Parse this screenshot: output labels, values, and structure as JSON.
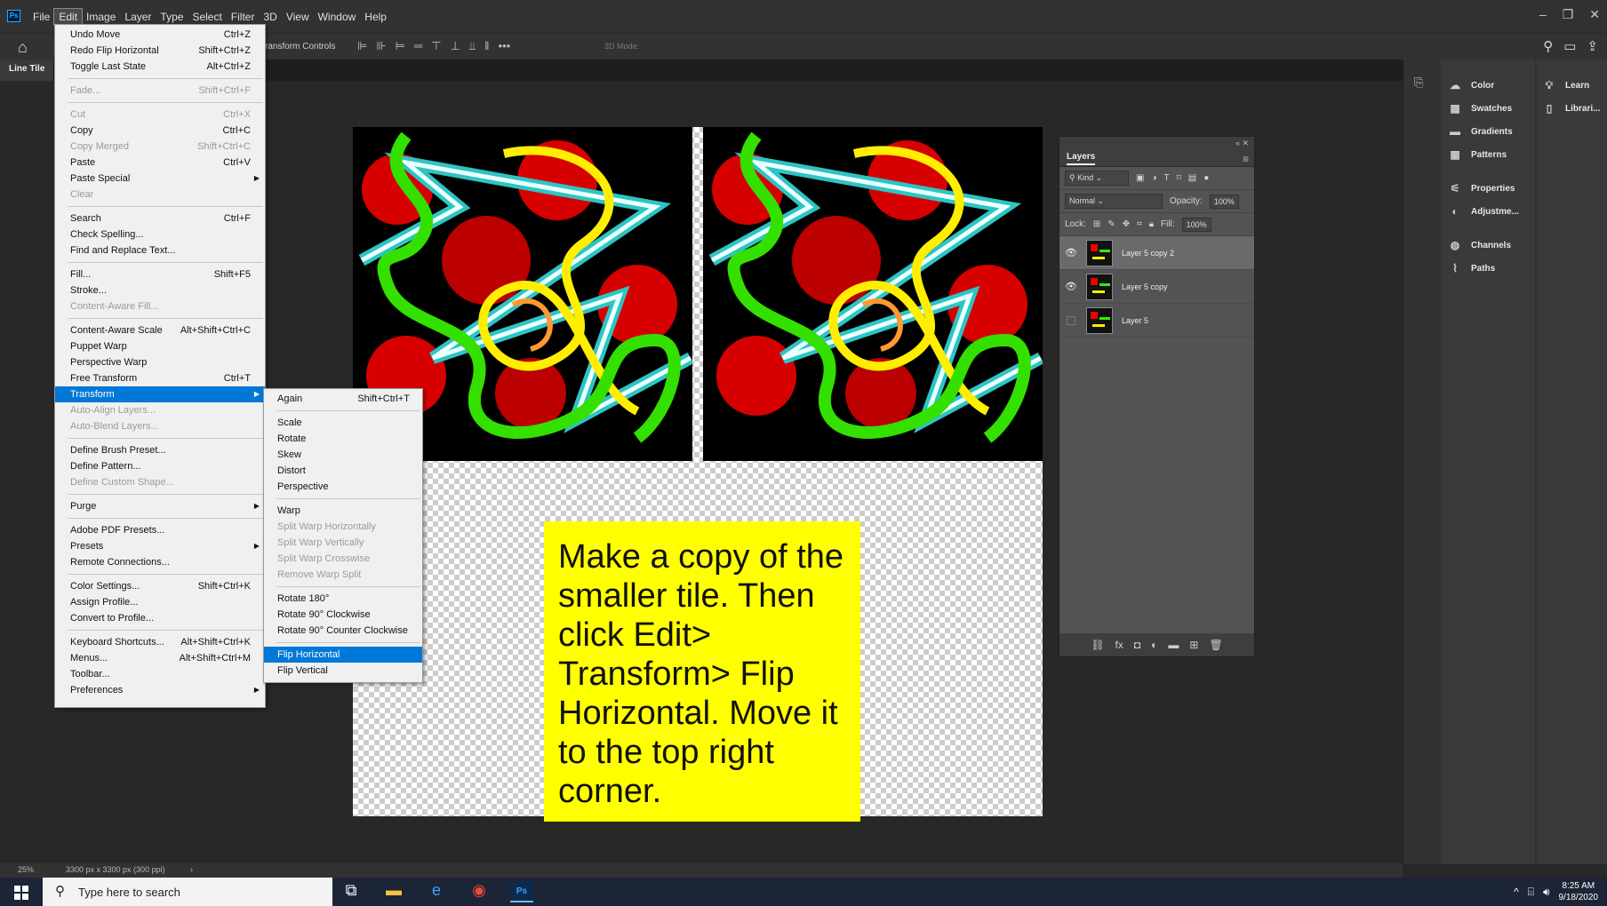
{
  "app": {
    "logo": "Ps",
    "menus": [
      "File",
      "Edit",
      "Image",
      "Layer",
      "Type",
      "Select",
      "Filter",
      "3D",
      "View",
      "Window",
      "Help"
    ],
    "active_menu": "Edit"
  },
  "optionsbar": {
    "transform_controls": "ransform Controls",
    "more": "•••",
    "mode_3d": "3D Mode:"
  },
  "document": {
    "tab_title": "Line Tile"
  },
  "edit_menu": {
    "undo": {
      "label": "Undo Move",
      "shortcut": "Ctrl+Z"
    },
    "redo": {
      "label": "Redo Flip Horizontal",
      "shortcut": "Shift+Ctrl+Z"
    },
    "toggle": {
      "label": "Toggle Last State",
      "shortcut": "Alt+Ctrl+Z"
    },
    "fade": {
      "label": "Fade...",
      "shortcut": "Shift+Ctrl+F"
    },
    "cut": {
      "label": "Cut",
      "shortcut": "Ctrl+X"
    },
    "copy": {
      "label": "Copy",
      "shortcut": "Ctrl+C"
    },
    "copy_merged": {
      "label": "Copy Merged",
      "shortcut": "Shift+Ctrl+C"
    },
    "paste": {
      "label": "Paste",
      "shortcut": "Ctrl+V"
    },
    "paste_special": {
      "label": "Paste Special"
    },
    "clear": {
      "label": "Clear"
    },
    "search": {
      "label": "Search",
      "shortcut": "Ctrl+F"
    },
    "check_spelling": {
      "label": "Check Spelling..."
    },
    "find_replace": {
      "label": "Find and Replace Text..."
    },
    "fill": {
      "label": "Fill...",
      "shortcut": "Shift+F5"
    },
    "stroke": {
      "label": "Stroke..."
    },
    "content_aware_fill": {
      "label": "Content-Aware Fill..."
    },
    "content_aware_scale": {
      "label": "Content-Aware Scale",
      "shortcut": "Alt+Shift+Ctrl+C"
    },
    "puppet_warp": {
      "label": "Puppet Warp"
    },
    "perspective_warp": {
      "label": "Perspective Warp"
    },
    "free_transform": {
      "label": "Free Transform",
      "shortcut": "Ctrl+T"
    },
    "transform": {
      "label": "Transform"
    },
    "auto_align": {
      "label": "Auto-Align Layers..."
    },
    "auto_blend": {
      "label": "Auto-Blend Layers..."
    },
    "define_brush": {
      "label": "Define Brush Preset..."
    },
    "define_pattern": {
      "label": "Define Pattern..."
    },
    "define_shape": {
      "label": "Define Custom Shape..."
    },
    "purge": {
      "label": "Purge"
    },
    "pdf_presets": {
      "label": "Adobe PDF Presets..."
    },
    "presets": {
      "label": "Presets"
    },
    "remote": {
      "label": "Remote Connections..."
    },
    "color_settings": {
      "label": "Color Settings...",
      "shortcut": "Shift+Ctrl+K"
    },
    "assign_profile": {
      "label": "Assign Profile..."
    },
    "convert_profile": {
      "label": "Convert to Profile..."
    },
    "keyboard": {
      "label": "Keyboard Shortcuts...",
      "shortcut": "Alt+Shift+Ctrl+K"
    },
    "menus": {
      "label": "Menus...",
      "shortcut": "Alt+Shift+Ctrl+M"
    },
    "toolbar": {
      "label": "Toolbar..."
    },
    "preferences": {
      "label": "Preferences"
    }
  },
  "transform_menu": {
    "again": {
      "label": "Again",
      "shortcut": "Shift+Ctrl+T"
    },
    "scale": "Scale",
    "rotate": "Rotate",
    "skew": "Skew",
    "distort": "Distort",
    "perspective": "Perspective",
    "warp": "Warp",
    "split_h": "Split Warp Horizontally",
    "split_v": "Split Warp Vertically",
    "split_c": "Split Warp Crosswise",
    "remove_split": "Remove Warp Split",
    "rotate180": "Rotate 180°",
    "rotate90cw": "Rotate 90° Clockwise",
    "rotate90ccw": "Rotate 90° Counter Clockwise",
    "flip_h": "Flip Horizontal",
    "flip_v": "Flip Vertical"
  },
  "note": {
    "text": "Make a copy of the smaller tile. Then click Edit> Transform> Flip Horizontal. Move it to the top right corner.",
    "bg_color": "#ffff00"
  },
  "layers_panel": {
    "title": "Layers",
    "filter": "Kind",
    "blend_mode": "Normal",
    "opacity_label": "Opacity:",
    "opacity": "100%",
    "lock_label": "Lock:",
    "fill_label": "Fill:",
    "fill": "100%",
    "layers": [
      {
        "name": "Layer 5 copy 2",
        "visible": true,
        "selected": true
      },
      {
        "name": "Layer 5 copy",
        "visible": true,
        "selected": false
      },
      {
        "name": "Layer 5",
        "visible": false,
        "selected": false
      }
    ]
  },
  "dock": {
    "col1": [
      "Color",
      "Swatches",
      "Gradients",
      "Patterns",
      "Properties",
      "Adjustme...",
      "Channels",
      "Paths"
    ],
    "col2": [
      "Learn",
      "Librari..."
    ]
  },
  "status": {
    "zoom": "25%",
    "doc_size": "3300 px x 3300 px (300 ppi)"
  },
  "taskbar": {
    "search_placeholder": "Type here to search",
    "ps_label": "Ps",
    "time": "8:25 AM",
    "date": "9/18/2020"
  },
  "colors": {
    "accent": "#0078d7",
    "ps_blue": "#31a8ff"
  }
}
